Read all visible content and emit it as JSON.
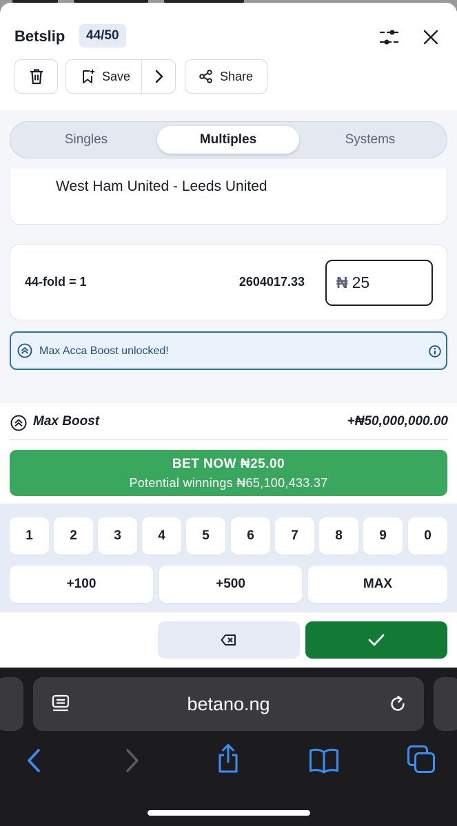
{
  "betslip": {
    "title": "Betslip",
    "count": "44/50",
    "toolbar": {
      "save_label": "Save",
      "share_label": "Share"
    },
    "tabs": [
      {
        "label": "Singles",
        "active": false
      },
      {
        "label": "Multiples",
        "active": true
      },
      {
        "label": "Systems",
        "active": false
      }
    ],
    "selection": {
      "match": "West Ham United - Leeds United"
    },
    "multiple": {
      "label": "44-fold = 1",
      "odds": "2604017.33",
      "currency": "₦",
      "stake": "25"
    },
    "boost_banner": {
      "text": "Max Acca Boost unlocked!"
    },
    "max_boost": {
      "label": "Max Boost",
      "value": "+₦50,000,000.00"
    },
    "bet_now": {
      "label": "BET NOW  ₦25.00",
      "potential": "Potential winnings ₦65,100,433.37"
    },
    "keypad": {
      "digits": [
        "1",
        "2",
        "3",
        "4",
        "5",
        "6",
        "7",
        "8",
        "9",
        "0"
      ],
      "quick": [
        "+100",
        "+500",
        "MAX"
      ]
    }
  },
  "browser": {
    "url": "betano.ng"
  },
  "colors": {
    "accent_green": "#39a75d",
    "confirm_green": "#117a35",
    "info_blue": "#2d6fb5",
    "ios_blue": "#3a8ef6"
  }
}
